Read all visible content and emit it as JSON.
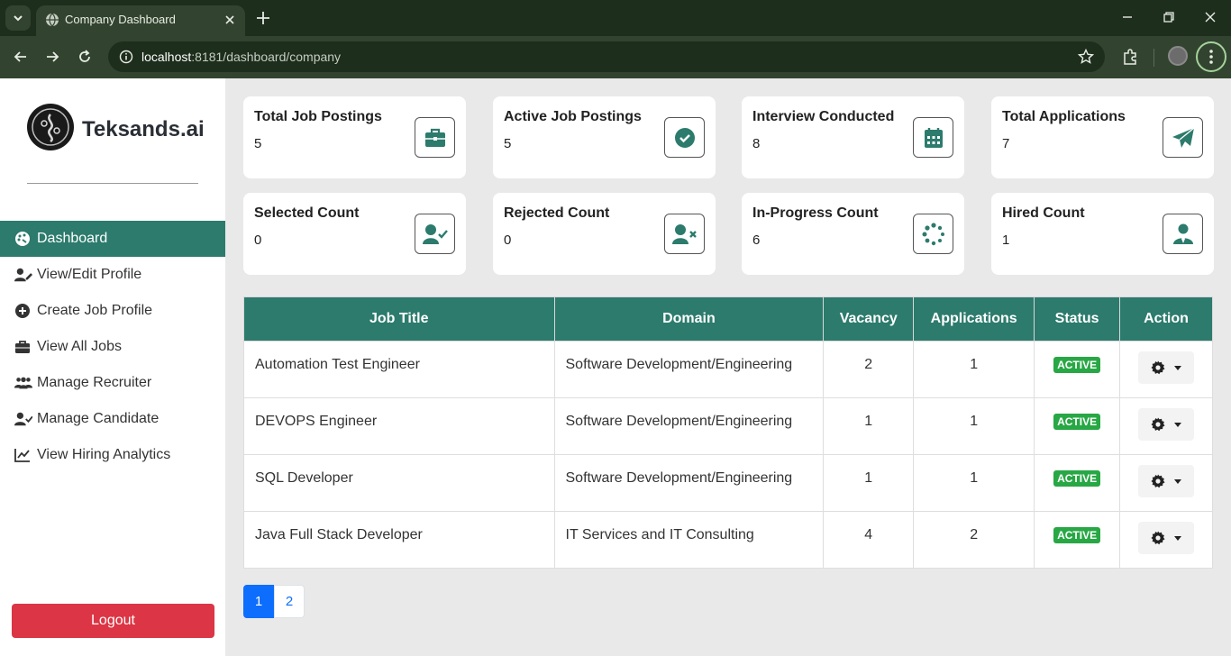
{
  "browser": {
    "tab_title": "Company Dashboard",
    "url_host": "localhost",
    "url_rest": ":8181/dashboard/company"
  },
  "sidebar": {
    "brand": "Teksands.ai",
    "items": [
      {
        "label": "Dashboard",
        "icon": "palette-icon",
        "active": true
      },
      {
        "label": "View/Edit Profile",
        "icon": "user-edit-icon"
      },
      {
        "label": "Create Job Profile",
        "icon": "plus-circle-icon"
      },
      {
        "label": "View All Jobs",
        "icon": "briefcase-icon"
      },
      {
        "label": "Manage Recruiter",
        "icon": "users-icon"
      },
      {
        "label": "Manage Candidate",
        "icon": "user-check-icon"
      },
      {
        "label": "View Hiring Analytics",
        "icon": "chart-line-icon"
      }
    ],
    "logout": "Logout"
  },
  "cards": [
    {
      "label": "Total Job Postings",
      "value": "5",
      "icon": "briefcase-icon"
    },
    {
      "label": "Active Job Postings",
      "value": "5",
      "icon": "check-circle-icon"
    },
    {
      "label": "Interview Conducted",
      "value": "8",
      "icon": "calendar-icon"
    },
    {
      "label": "Total Applications",
      "value": "7",
      "icon": "paper-plane-icon"
    },
    {
      "label": "Selected Count",
      "value": "0",
      "icon": "user-check-icon"
    },
    {
      "label": "Rejected Count",
      "value": "0",
      "icon": "user-times-icon"
    },
    {
      "label": "In-Progress Count",
      "value": "6",
      "icon": "spinner-icon"
    },
    {
      "label": "Hired Count",
      "value": "1",
      "icon": "user-tie-icon"
    }
  ],
  "table": {
    "headers": [
      "Job Title",
      "Domain",
      "Vacancy",
      "Applications",
      "Status",
      "Action"
    ],
    "rows": [
      {
        "title": "Automation Test Engineer",
        "domain": "Software Development/Engineering",
        "vacancy": "2",
        "applications": "1",
        "status": "ACTIVE"
      },
      {
        "title": "DEVOPS Engineer",
        "domain": "Software Development/Engineering",
        "vacancy": "1",
        "applications": "1",
        "status": "ACTIVE"
      },
      {
        "title": "SQL Developer",
        "domain": "Software Development/Engineering",
        "vacancy": "1",
        "applications": "1",
        "status": "ACTIVE"
      },
      {
        "title": "Java Full Stack Developer",
        "domain": "IT Services and IT Consulting",
        "vacancy": "4",
        "applications": "2",
        "status": "ACTIVE"
      }
    ]
  },
  "pagination": {
    "pages": [
      "1",
      "2"
    ],
    "current": "1"
  },
  "colors": {
    "primary": "#2c7b6d",
    "danger": "#dc3545",
    "success": "#28a745",
    "link": "#0d6efd"
  }
}
